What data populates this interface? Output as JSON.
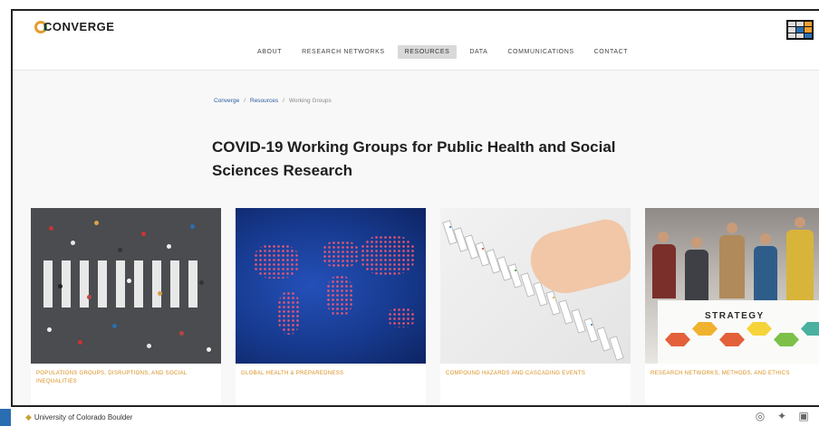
{
  "header": {
    "logo_text": "CONVERGE",
    "nav": [
      {
        "label": "About",
        "active": false
      },
      {
        "label": "Research Networks",
        "active": false
      },
      {
        "label": "Resources",
        "active": true
      },
      {
        "label": "Data",
        "active": false
      },
      {
        "label": "Communications",
        "active": false
      },
      {
        "label": "Contact",
        "active": false
      }
    ]
  },
  "breadcrumb": [
    "Converge",
    "Resources",
    "Working Groups"
  ],
  "page_title": "COVID-19 Working Groups for Public Health and Social Sciences Research",
  "cards": [
    {
      "label": "Populations Groups, Disruptions, and Social Inequalities",
      "image": "crosswalk-crowd"
    },
    {
      "label": "Global Health & Preparedness",
      "image": "world-map"
    },
    {
      "label": "Compound Hazards and Cascading Events",
      "image": "dominoes"
    },
    {
      "label": "Research Networks, Methods, and Ethics",
      "image": "strategy-meeting"
    }
  ],
  "card_image_text": {
    "strategy": "STRATEGY"
  },
  "footer": {
    "university": "University of Colorado Boulder",
    "social_icons": [
      "instagram-icon",
      "twitter-icon",
      "linkedin-icon"
    ]
  },
  "colors": {
    "accent_orange": "#d88f1f",
    "footer_tab_blue": "#2b6db3",
    "nav_active_bg": "#d9d9d9"
  }
}
